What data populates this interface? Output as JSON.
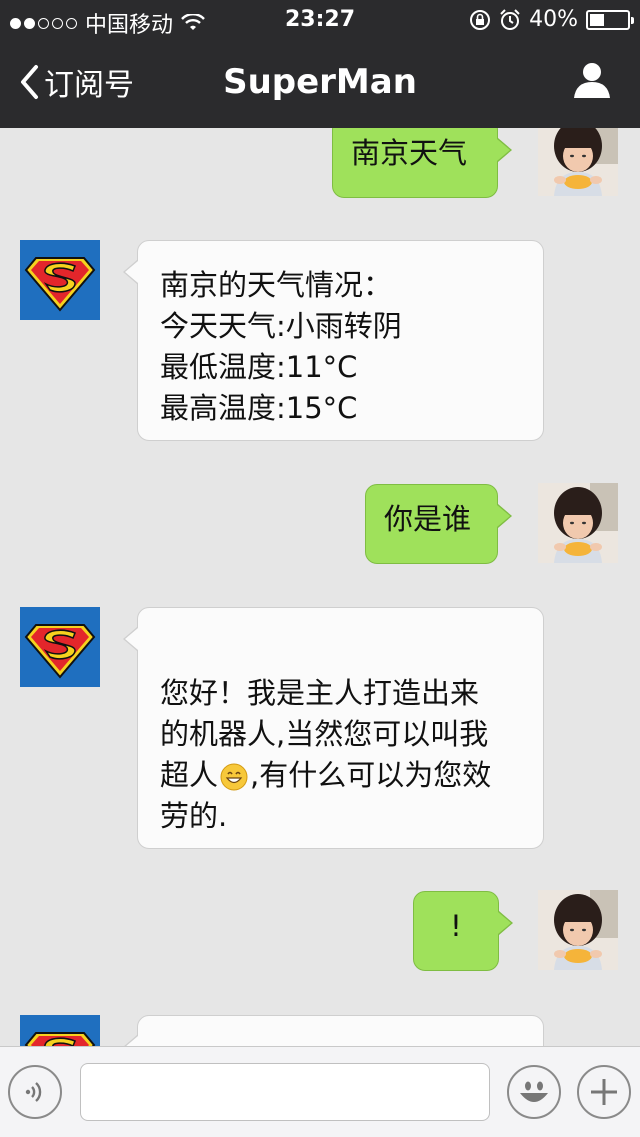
{
  "status_bar": {
    "carrier": "中国移动",
    "time": "23:27",
    "battery": "40%",
    "battery_level": 0.4,
    "signal_dots_filled": 2,
    "signal_dots_total": 5
  },
  "nav": {
    "back_label": "订阅号",
    "title": "SuperMan"
  },
  "messages": [
    {
      "from": "me",
      "lines": [
        "南京天气"
      ]
    },
    {
      "from": "bot",
      "lines": [
        "南京的天气情况：",
        "今天天气:小雨转阴",
        "最低温度:11°C",
        "最高温度:15°C"
      ]
    },
    {
      "from": "me",
      "lines": [
        "你是谁"
      ]
    },
    {
      "from": "bot",
      "lines": [
        "",
        "您好！我是主人打造出来",
        "的机器人,当然您可以叫我",
        "超人",
        ",有什么可以为您效",
        "劳的."
      ]
    },
    {
      "from": "me",
      "lines": [
        "!"
      ]
    }
  ],
  "input_bar": {
    "text_value": ""
  },
  "colors": {
    "nav_bg": "#2b2b2d",
    "chat_bg": "#e6e6e6",
    "my_bubble": "#9fe15b",
    "bot_bubble": "#fbfbfb",
    "superman_blue": "#1f6fbf",
    "superman_red": "#e3262b",
    "superman_yellow": "#f6d21e"
  },
  "icons": {
    "back": "chevron-left-icon",
    "contact": "person-icon",
    "voice": "voice-icon",
    "emoji": "smiley-icon",
    "more": "plus-icon",
    "bot_avatar": "superman-logo",
    "inline_emoji": "grinning-emoji"
  }
}
